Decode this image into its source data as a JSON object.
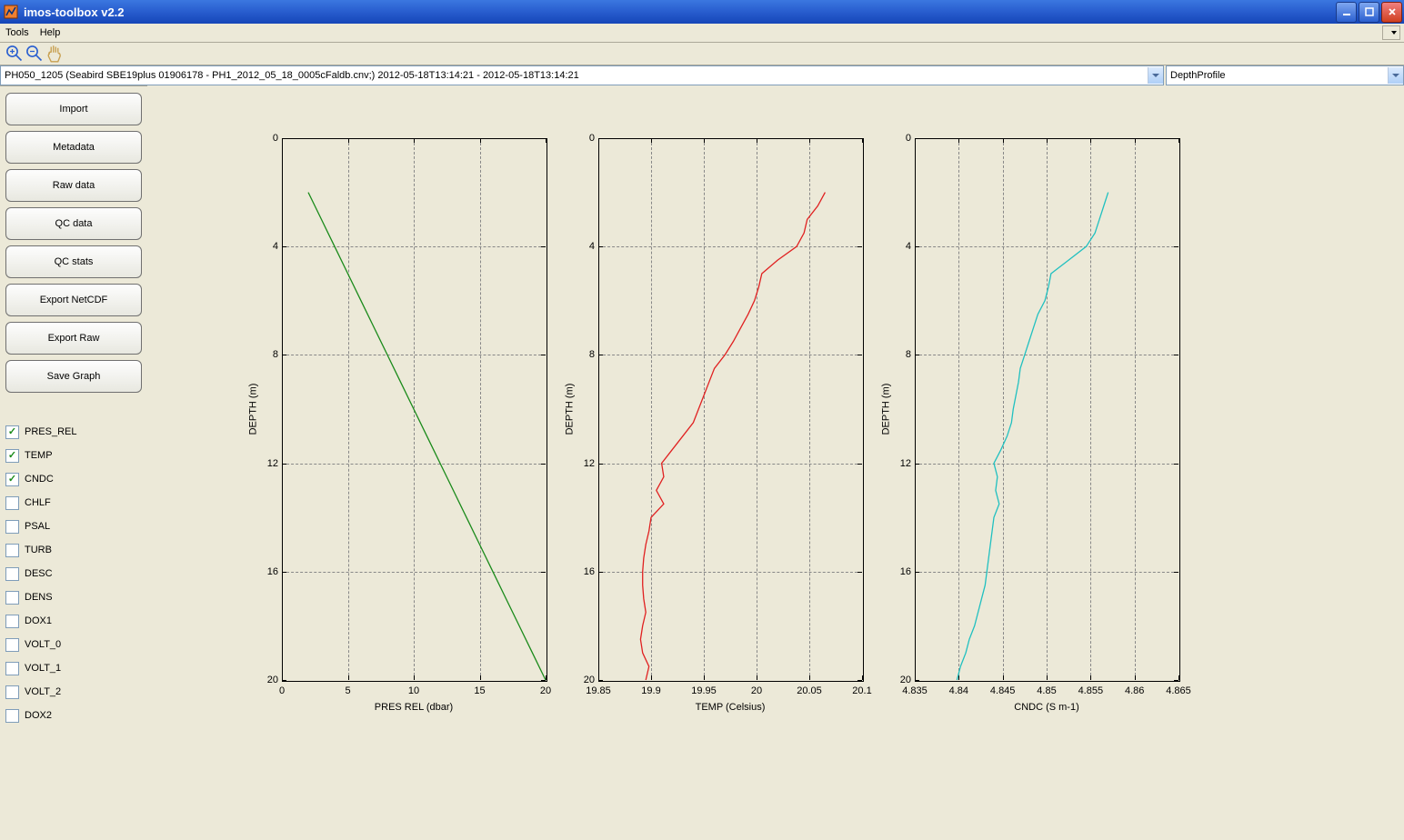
{
  "window": {
    "title": "imos-toolbox v2.2"
  },
  "menubar": {
    "items": [
      "Tools",
      "Help"
    ]
  },
  "toolbar": {
    "icons": [
      "zoom-in-icon",
      "zoom-out-icon",
      "pan-icon"
    ]
  },
  "selectors": {
    "dataset": "PH050_1205 (Seabird SBE19plus 01906178 - PH1_2012_05_18_0005cFaldb.cnv;) 2012-05-18T13:14:21 - 2012-05-18T13:14:21",
    "view": "DepthProfile"
  },
  "sidebar": {
    "buttons": [
      "Import",
      "Metadata",
      "Raw data",
      "QC data",
      "QC stats",
      "Export NetCDF",
      "Export Raw",
      "Save Graph"
    ],
    "variables": [
      {
        "name": "PRES_REL",
        "checked": true
      },
      {
        "name": "TEMP",
        "checked": true
      },
      {
        "name": "CNDC",
        "checked": true
      },
      {
        "name": "CHLF",
        "checked": false
      },
      {
        "name": "PSAL",
        "checked": false
      },
      {
        "name": "TURB",
        "checked": false
      },
      {
        "name": "DESC",
        "checked": false
      },
      {
        "name": "DENS",
        "checked": false
      },
      {
        "name": "DOX1",
        "checked": false
      },
      {
        "name": "VOLT_0",
        "checked": false
      },
      {
        "name": "VOLT_1",
        "checked": false
      },
      {
        "name": "VOLT_2",
        "checked": false
      },
      {
        "name": "DOX2",
        "checked": false
      }
    ]
  },
  "charts": [
    {
      "id": "pres",
      "ylabel": "DEPTH (m)",
      "xlabel": "PRES REL (dbar)",
      "ylim": [
        0,
        20
      ],
      "yticks": [
        0,
        4,
        8,
        12,
        16,
        20
      ],
      "xlim": [
        0,
        20
      ],
      "xticks": [
        0,
        5,
        10,
        15,
        20
      ],
      "color": "#1a8a1a"
    },
    {
      "id": "temp",
      "ylabel": "DEPTH (m)",
      "xlabel": "TEMP (Celsius)",
      "ylim": [
        0,
        20
      ],
      "yticks": [
        0,
        4,
        8,
        12,
        16,
        20
      ],
      "xlim": [
        19.85,
        20.1
      ],
      "xticks": [
        19.85,
        19.9,
        19.95,
        20,
        20.05,
        20.1
      ],
      "color": "#e02020"
    },
    {
      "id": "cndc",
      "ylabel": "DEPTH (m)",
      "xlabel": "CNDC (S m-1)",
      "ylim": [
        0,
        20
      ],
      "yticks": [
        0,
        4,
        8,
        12,
        16,
        20
      ],
      "xlim": [
        4.835,
        4.865
      ],
      "xticks": [
        4.835,
        4.84,
        4.845,
        4.85,
        4.855,
        4.86,
        4.865
      ],
      "color": "#20c0c0"
    }
  ],
  "chart_data": [
    {
      "type": "line",
      "title": "",
      "xlabel": "PRES REL (dbar)",
      "ylabel": "DEPTH (m)",
      "xlim": [
        0,
        20
      ],
      "ylim": [
        0,
        20
      ],
      "y_inverted": true,
      "series": [
        {
          "name": "PRES_REL",
          "color": "#1a8a1a",
          "points": [
            {
              "depth": 2.0,
              "value": 2.0
            },
            {
              "depth": 3.0,
              "value": 3.0
            },
            {
              "depth": 4.0,
              "value": 4.0
            },
            {
              "depth": 5.0,
              "value": 5.0
            },
            {
              "depth": 6.0,
              "value": 6.0
            },
            {
              "depth": 7.0,
              "value": 7.0
            },
            {
              "depth": 8.0,
              "value": 8.0
            },
            {
              "depth": 9.0,
              "value": 9.0
            },
            {
              "depth": 10.0,
              "value": 10.0
            },
            {
              "depth": 11.0,
              "value": 11.0
            },
            {
              "depth": 12.0,
              "value": 12.0
            },
            {
              "depth": 13.0,
              "value": 13.0
            },
            {
              "depth": 14.0,
              "value": 14.0
            },
            {
              "depth": 15.0,
              "value": 15.0
            },
            {
              "depth": 16.0,
              "value": 16.0
            },
            {
              "depth": 17.0,
              "value": 17.0
            },
            {
              "depth": 18.0,
              "value": 18.0
            },
            {
              "depth": 19.0,
              "value": 19.0
            },
            {
              "depth": 20.0,
              "value": 20.0
            }
          ]
        }
      ]
    },
    {
      "type": "line",
      "title": "",
      "xlabel": "TEMP (Celsius)",
      "ylabel": "DEPTH (m)",
      "xlim": [
        19.85,
        20.1
      ],
      "ylim": [
        0,
        20
      ],
      "y_inverted": true,
      "series": [
        {
          "name": "TEMP",
          "color": "#e02020",
          "points": [
            {
              "depth": 2.0,
              "value": 20.065
            },
            {
              "depth": 2.5,
              "value": 20.058
            },
            {
              "depth": 3.0,
              "value": 20.048
            },
            {
              "depth": 3.5,
              "value": 20.045
            },
            {
              "depth": 4.0,
              "value": 20.038
            },
            {
              "depth": 4.5,
              "value": 20.02
            },
            {
              "depth": 5.0,
              "value": 20.005
            },
            {
              "depth": 5.5,
              "value": 20.002
            },
            {
              "depth": 6.0,
              "value": 19.998
            },
            {
              "depth": 6.5,
              "value": 19.992
            },
            {
              "depth": 7.0,
              "value": 19.985
            },
            {
              "depth": 7.5,
              "value": 19.978
            },
            {
              "depth": 8.0,
              "value": 19.97
            },
            {
              "depth": 8.5,
              "value": 19.96
            },
            {
              "depth": 9.0,
              "value": 19.955
            },
            {
              "depth": 9.5,
              "value": 19.95
            },
            {
              "depth": 10.0,
              "value": 19.945
            },
            {
              "depth": 10.5,
              "value": 19.94
            },
            {
              "depth": 11.0,
              "value": 19.93
            },
            {
              "depth": 11.5,
              "value": 19.92
            },
            {
              "depth": 12.0,
              "value": 19.91
            },
            {
              "depth": 12.5,
              "value": 19.912
            },
            {
              "depth": 13.0,
              "value": 19.905
            },
            {
              "depth": 13.5,
              "value": 19.912
            },
            {
              "depth": 14.0,
              "value": 19.9
            },
            {
              "depth": 14.5,
              "value": 19.898
            },
            {
              "depth": 15.0,
              "value": 19.895
            },
            {
              "depth": 15.5,
              "value": 19.893
            },
            {
              "depth": 16.0,
              "value": 19.892
            },
            {
              "depth": 16.5,
              "value": 19.892
            },
            {
              "depth": 17.0,
              "value": 19.893
            },
            {
              "depth": 17.5,
              "value": 19.895
            },
            {
              "depth": 18.0,
              "value": 19.892
            },
            {
              "depth": 18.5,
              "value": 19.89
            },
            {
              "depth": 19.0,
              "value": 19.892
            },
            {
              "depth": 19.5,
              "value": 19.898
            },
            {
              "depth": 20.0,
              "value": 19.895
            }
          ]
        }
      ]
    },
    {
      "type": "line",
      "title": "",
      "xlabel": "CNDC (S m-1)",
      "ylabel": "DEPTH (m)",
      "xlim": [
        4.835,
        4.865
      ],
      "ylim": [
        0,
        20
      ],
      "y_inverted": true,
      "series": [
        {
          "name": "CNDC",
          "color": "#20c0c0",
          "points": [
            {
              "depth": 2.0,
              "value": 4.857
            },
            {
              "depth": 2.5,
              "value": 4.8565
            },
            {
              "depth": 3.0,
              "value": 4.856
            },
            {
              "depth": 3.5,
              "value": 4.8555
            },
            {
              "depth": 4.0,
              "value": 4.8545
            },
            {
              "depth": 4.5,
              "value": 4.8525
            },
            {
              "depth": 5.0,
              "value": 4.8505
            },
            {
              "depth": 5.5,
              "value": 4.8502
            },
            {
              "depth": 6.0,
              "value": 4.8498
            },
            {
              "depth": 6.5,
              "value": 4.849
            },
            {
              "depth": 7.0,
              "value": 4.8485
            },
            {
              "depth": 7.5,
              "value": 4.848
            },
            {
              "depth": 8.0,
              "value": 4.8475
            },
            {
              "depth": 8.5,
              "value": 4.847
            },
            {
              "depth": 9.0,
              "value": 4.8468
            },
            {
              "depth": 9.5,
              "value": 4.8465
            },
            {
              "depth": 10.0,
              "value": 4.8462
            },
            {
              "depth": 10.5,
              "value": 4.846
            },
            {
              "depth": 11.0,
              "value": 4.8455
            },
            {
              "depth": 11.5,
              "value": 4.8448
            },
            {
              "depth": 12.0,
              "value": 4.844
            },
            {
              "depth": 12.5,
              "value": 4.8444
            },
            {
              "depth": 13.0,
              "value": 4.8442
            },
            {
              "depth": 13.5,
              "value": 4.8446
            },
            {
              "depth": 14.0,
              "value": 4.844
            },
            {
              "depth": 14.5,
              "value": 4.8438
            },
            {
              "depth": 15.0,
              "value": 4.8436
            },
            {
              "depth": 15.5,
              "value": 4.8434
            },
            {
              "depth": 16.0,
              "value": 4.8432
            },
            {
              "depth": 16.5,
              "value": 4.843
            },
            {
              "depth": 17.0,
              "value": 4.8426
            },
            {
              "depth": 17.5,
              "value": 4.8422
            },
            {
              "depth": 18.0,
              "value": 4.8418
            },
            {
              "depth": 18.5,
              "value": 4.8412
            },
            {
              "depth": 19.0,
              "value": 4.8408
            },
            {
              "depth": 19.5,
              "value": 4.8402
            },
            {
              "depth": 20.0,
              "value": 4.8398
            }
          ]
        }
      ]
    }
  ]
}
